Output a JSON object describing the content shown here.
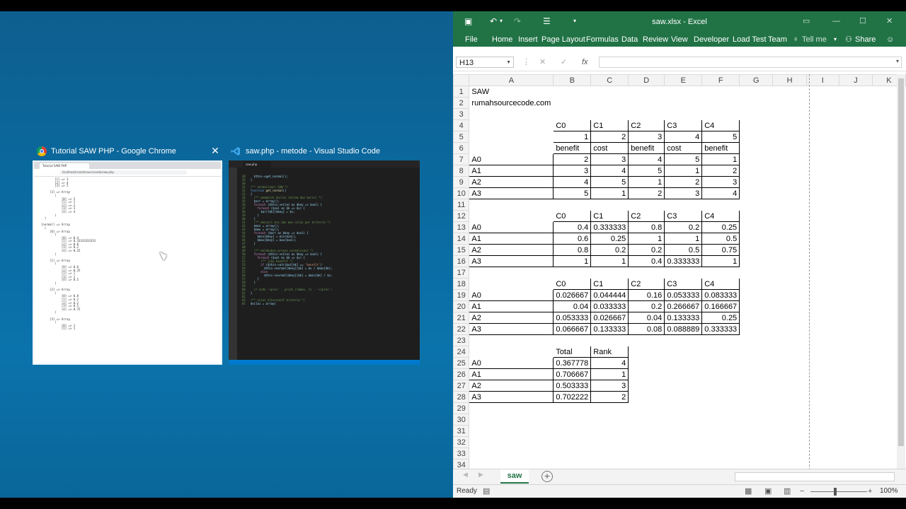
{
  "task_switcher": {
    "chrome_title": "Tutorial SAW PHP - Google Chrome",
    "vscode_title": "saw.php - metode - Visual Studio Code",
    "chrome_tab": "Tutorial SAW PHP",
    "chrome_url": "localhost/rumahsourcecode/saw.php",
    "vscode_tab": "saw.php"
  },
  "excel": {
    "title": "saw.xlsx - Excel",
    "ribbon_tabs": [
      "File",
      "Home",
      "Insert",
      "Page Layout",
      "Formulas",
      "Data",
      "Review",
      "View",
      "Developer",
      "Load Test",
      "Team"
    ],
    "tell_me": "Tell me",
    "share": "Share",
    "name_box": "H13",
    "columns": [
      "A",
      "B",
      "C",
      "D",
      "E",
      "F",
      "G",
      "H",
      "I",
      "J",
      "K"
    ],
    "sheet_tab": "saw",
    "status": "Ready",
    "zoom": "100%"
  },
  "cells": {
    "r1": {
      "A": "SAW"
    },
    "r2": {
      "A": "rumahsourcecode.com"
    },
    "r4": {
      "B": "C0",
      "C": "C1",
      "D": "C2",
      "E": "C3",
      "F": "C4"
    },
    "r5": {
      "B": "1",
      "C": "2",
      "D": "3",
      "E": "4",
      "F": "5"
    },
    "r6": {
      "B": "benefit",
      "C": "cost",
      "D": "benefit",
      "E": "cost",
      "F": "benefit"
    },
    "r7": {
      "A": "A0",
      "B": "2",
      "C": "3",
      "D": "4",
      "E": "5",
      "F": "1"
    },
    "r8": {
      "A": "A1",
      "B": "3",
      "C": "4",
      "D": "5",
      "E": "1",
      "F": "2"
    },
    "r9": {
      "A": "A2",
      "B": "4",
      "C": "5",
      "D": "1",
      "E": "2",
      "F": "3"
    },
    "r10": {
      "A": "A3",
      "B": "5",
      "C": "1",
      "D": "2",
      "E": "3",
      "F": "4"
    },
    "r12": {
      "B": "C0",
      "C": "C1",
      "D": "C2",
      "E": "C3",
      "F": "C4"
    },
    "r13": {
      "A": "A0",
      "B": "0.4",
      "C": "0.333333",
      "D": "0.8",
      "E": "0.2",
      "F": "0.25"
    },
    "r14": {
      "A": "A1",
      "B": "0.6",
      "C": "0.25",
      "D": "1",
      "E": "1",
      "F": "0.5"
    },
    "r15": {
      "A": "A2",
      "B": "0.8",
      "C": "0.2",
      "D": "0.2",
      "E": "0.5",
      "F": "0.75"
    },
    "r16": {
      "A": "A3",
      "B": "1",
      "C": "1",
      "D": "0.4",
      "E": "0.333333",
      "F": "1"
    },
    "r18": {
      "B": "C0",
      "C": "C1",
      "D": "C2",
      "E": "C3",
      "F": "C4"
    },
    "r19": {
      "A": "A0",
      "B": "0.026667",
      "C": "0.044444",
      "D": "0.16",
      "E": "0.053333",
      "F": "0.083333"
    },
    "r20": {
      "A": "A1",
      "B": "0.04",
      "C": "0.033333",
      "D": "0.2",
      "E": "0.266667",
      "F": "0.166667"
    },
    "r21": {
      "A": "A2",
      "B": "0.053333",
      "C": "0.026667",
      "D": "0.04",
      "E": "0.133333",
      "F": "0.25"
    },
    "r22": {
      "A": "A3",
      "B": "0.066667",
      "C": "0.133333",
      "D": "0.08",
      "E": "0.088889",
      "F": "0.333333"
    },
    "r24": {
      "B": "Total",
      "C": "Rank"
    },
    "r25": {
      "A": "A0",
      "B": "0.367778",
      "C": "4"
    },
    "r26": {
      "A": "A1",
      "B": "0.706667",
      "C": "1"
    },
    "r27": {
      "A": "A2",
      "B": "0.503333",
      "C": "3"
    },
    "r28": {
      "A": "A3",
      "B": "0.702222",
      "C": "2"
    }
  },
  "colors": {
    "excel_green": "#217346",
    "desktop_blue": "#0a6aa0"
  }
}
